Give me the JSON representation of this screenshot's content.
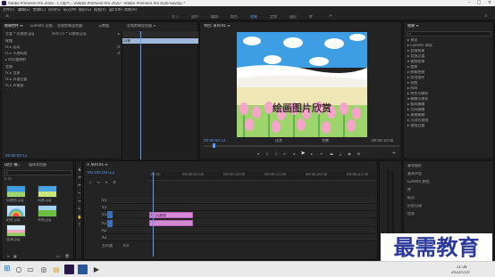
{
  "app": {
    "title": "Adobe Premiere Pro 2020 - C:\\用户\\...\\Adobe Premiere Pro 2020 - Adobe Premiere Pro Auto-Save\\p *",
    "menu": [
      "文件(F)",
      "编辑(E)",
      "剪辑(C)",
      "序列(S)",
      "标记(M)",
      "图形(G)",
      "视图(V)",
      "窗口(W)",
      "帮助(H)"
    ],
    "workspaces": [
      "学习",
      "组件",
      "编辑",
      "颜色",
      "效果",
      "音频",
      "图形",
      "库"
    ],
    "active_workspace": "效果"
  },
  "effect_controls": {
    "tabs": [
      "效果控件 ≡",
      "Lumetri 范围",
      "音频剪辑混合器：序列 01",
      "元数据",
      "音频剪辑混合器 ≡"
    ],
    "source_label": "主要 * 风景图.jpg",
    "clip_label": "序列 01 * 风景图.jpg",
    "section_video": "视频",
    "rows": [
      "fx  ▸ 运动",
      "fx  ▸ 不透明度",
      "   ▸ 时间重映射"
    ],
    "section_audio": "音频",
    "audio_rows": [
      "fx  ▸ 音量",
      "fx  ▸ 声道音量",
      "fx  ▸ 声像器"
    ],
    "clip_chip": "风景",
    "timecode": "00:00:00:12"
  },
  "program": {
    "tab": "节目: 序列 01 ≡",
    "image_caption": "绘画图片欣赏",
    "timecode_left": "00:00:00:12",
    "fit": "适合",
    "quality": "完整",
    "timecode_right": "00:00:10:00"
  },
  "project": {
    "tabs": [
      "项目: 微...",
      "媒体浏览器"
    ],
    "search_placeholder": "",
    "count": "5 项",
    "items": [
      {
        "name": "风景图.jpg",
        "dur": "4:24"
      },
      {
        "name": "风景.jpg",
        "dur": "4:24"
      },
      {
        "name": "彩虹.jpg",
        "dur": "4:24"
      },
      {
        "name": "草地.jpg",
        "dur": "4:24"
      },
      {
        "name": "花海.jpg",
        "dur": "4:24"
      }
    ]
  },
  "timeline": {
    "tab": "× 序列 01 ≡",
    "timecode": "00:00:00:12",
    "ruler": [
      "00:00",
      "00:00:05:00",
      "00:00:10:00",
      "00:00:15:00",
      "00:00:20:00",
      "00:00:25:00"
    ],
    "tracks": [
      "V3",
      "V2",
      "V1",
      "A1",
      "A2",
      "A3"
    ],
    "master": "主声道",
    "master_value": "0.0",
    "clip_label": "fx 风景图"
  },
  "effects": {
    "tab": "效果 ≡",
    "tree": [
      "▸ 预设",
      "▸ Lumetri 预设",
      "▸ 音频效果",
      "▸ 音频过渡",
      "▾ 视频效果",
      "   ▸ 变换",
      "   ▸ 图像控制",
      "   ▸ 实用程序",
      "   ▸ 扭曲",
      "   ▸ 时间",
      "   ▸ 杂色与颗粒",
      "   ▾ 模糊与锐化",
      "      ▸ 相机模糊",
      "      ▸ 方向模糊",
      "      ▸ 通道模糊",
      "   ▸ 沉浸式视频",
      "▸ 视频过渡"
    ],
    "lower_tabs": [
      "基本图形",
      "基本声音",
      "Lumetri 颜色",
      "库",
      "标记",
      "历史记录",
      "信息"
    ]
  },
  "taskbar": {
    "search_placeholder": "在这里输入你要搜索的内容",
    "time": "11:38",
    "date": "2022/1/10"
  },
  "watermark": "最需教育",
  "colors": {
    "accent": "#5b9cff",
    "clip": "#d98ad8",
    "playhead": "#5b9cff"
  }
}
